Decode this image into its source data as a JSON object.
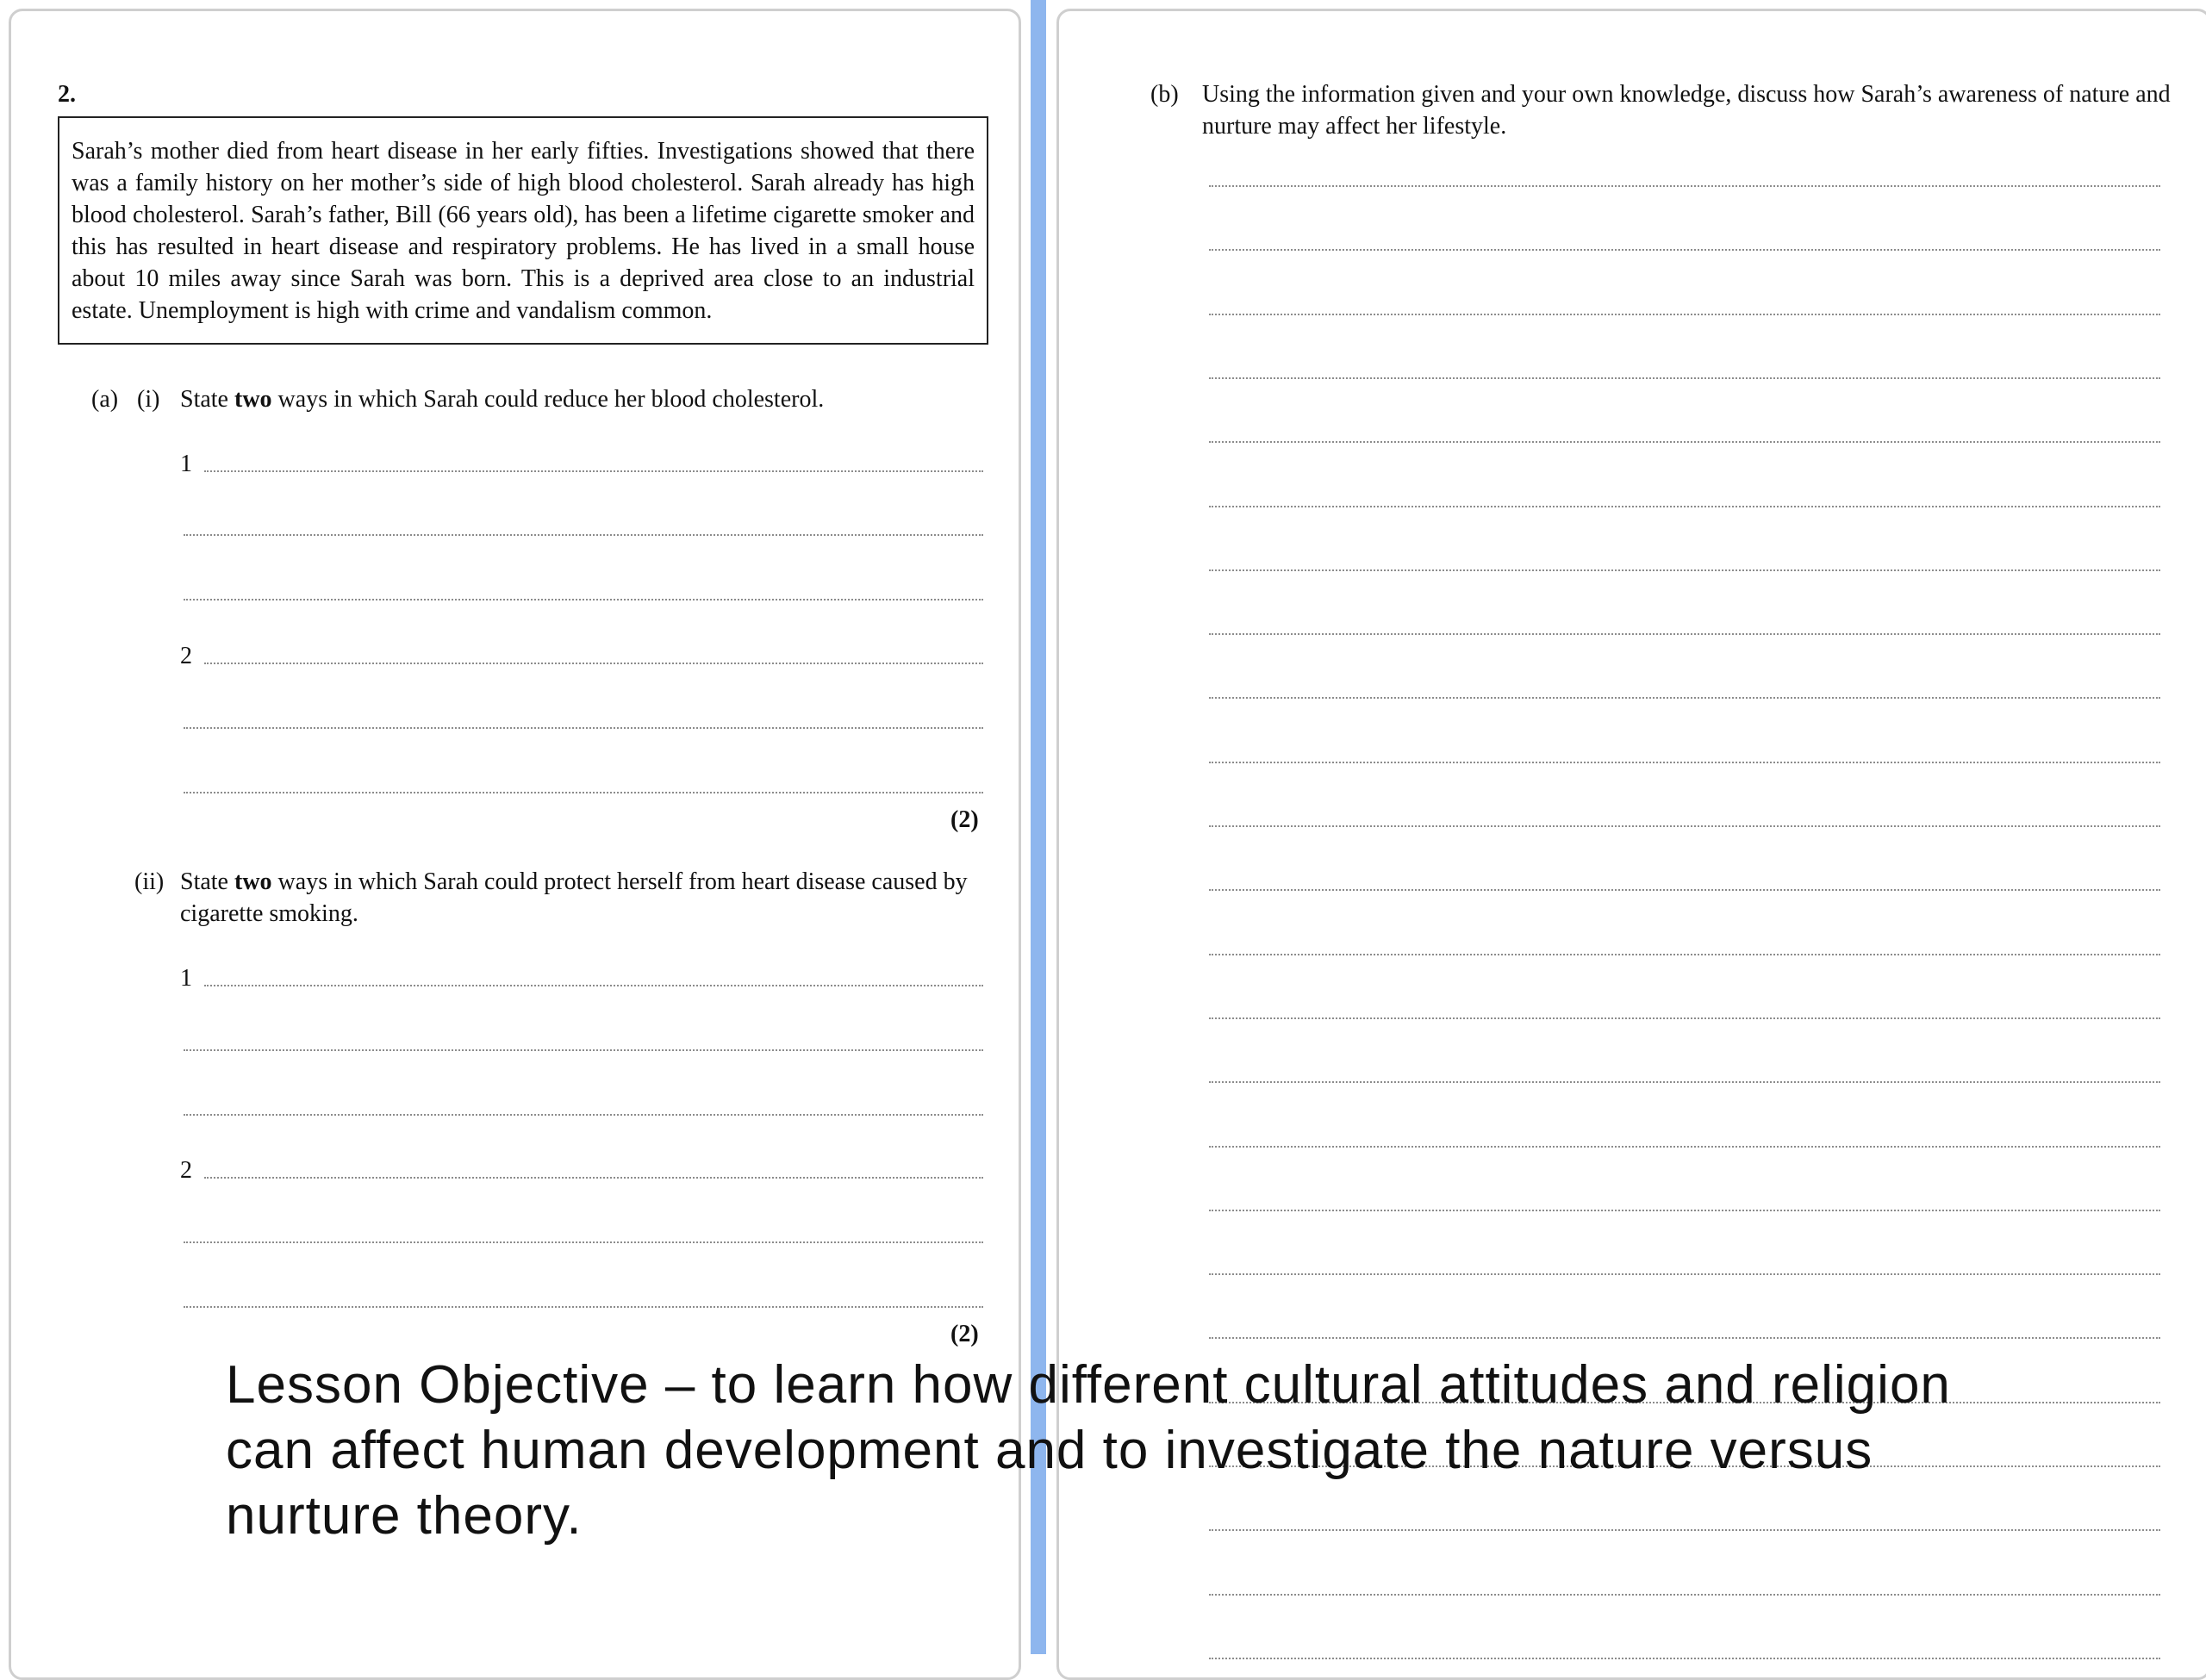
{
  "question": {
    "number": "2.",
    "scenario": "Sarah’s mother died from heart disease in her early fifties.  Investigations showed that there was a family history on her mother’s side of high blood cholesterol.  Sarah already has high blood cholesterol.  Sarah’s father, Bill (66 years old), has been a lifetime cigarette smoker and this has resulted in heart disease and respiratory problems.  He has lived in a small house about 10 miles away since Sarah was born.  This is a deprived area close to an industrial estate.  Unemployment is high with crime and vandalism common.",
    "part_a": {
      "label": "(a)",
      "i": {
        "label": "(i)",
        "text_before": "State ",
        "bold": "two",
        "text_after": " ways in which Sarah could reduce her blood cholesterol.",
        "answer_1": "1",
        "answer_2": "2",
        "marks": "(2)"
      },
      "ii": {
        "label": "(ii)",
        "text_before": "State ",
        "bold": "two",
        "text_after": " ways in which Sarah could protect herself from heart disease caused by cigarette smoking.",
        "answer_1": "1",
        "answer_2": "2",
        "marks": "(2)"
      }
    },
    "part_b": {
      "label": "(b)",
      "text": "Using the information given and your own knowledge, discuss how Sarah’s awareness of nature and nurture may affect her lifestyle."
    }
  },
  "objective": {
    "line1": "Lesson Objective – to learn how different cultural attitudes and religion",
    "line2": "can affect human development and to investigate the nature versus",
    "line3": "nurture theory."
  },
  "colors": {
    "divider": "#8eb6ee",
    "page_border": "#cfcfcf",
    "dotted_rule": "#8c8c8c"
  }
}
